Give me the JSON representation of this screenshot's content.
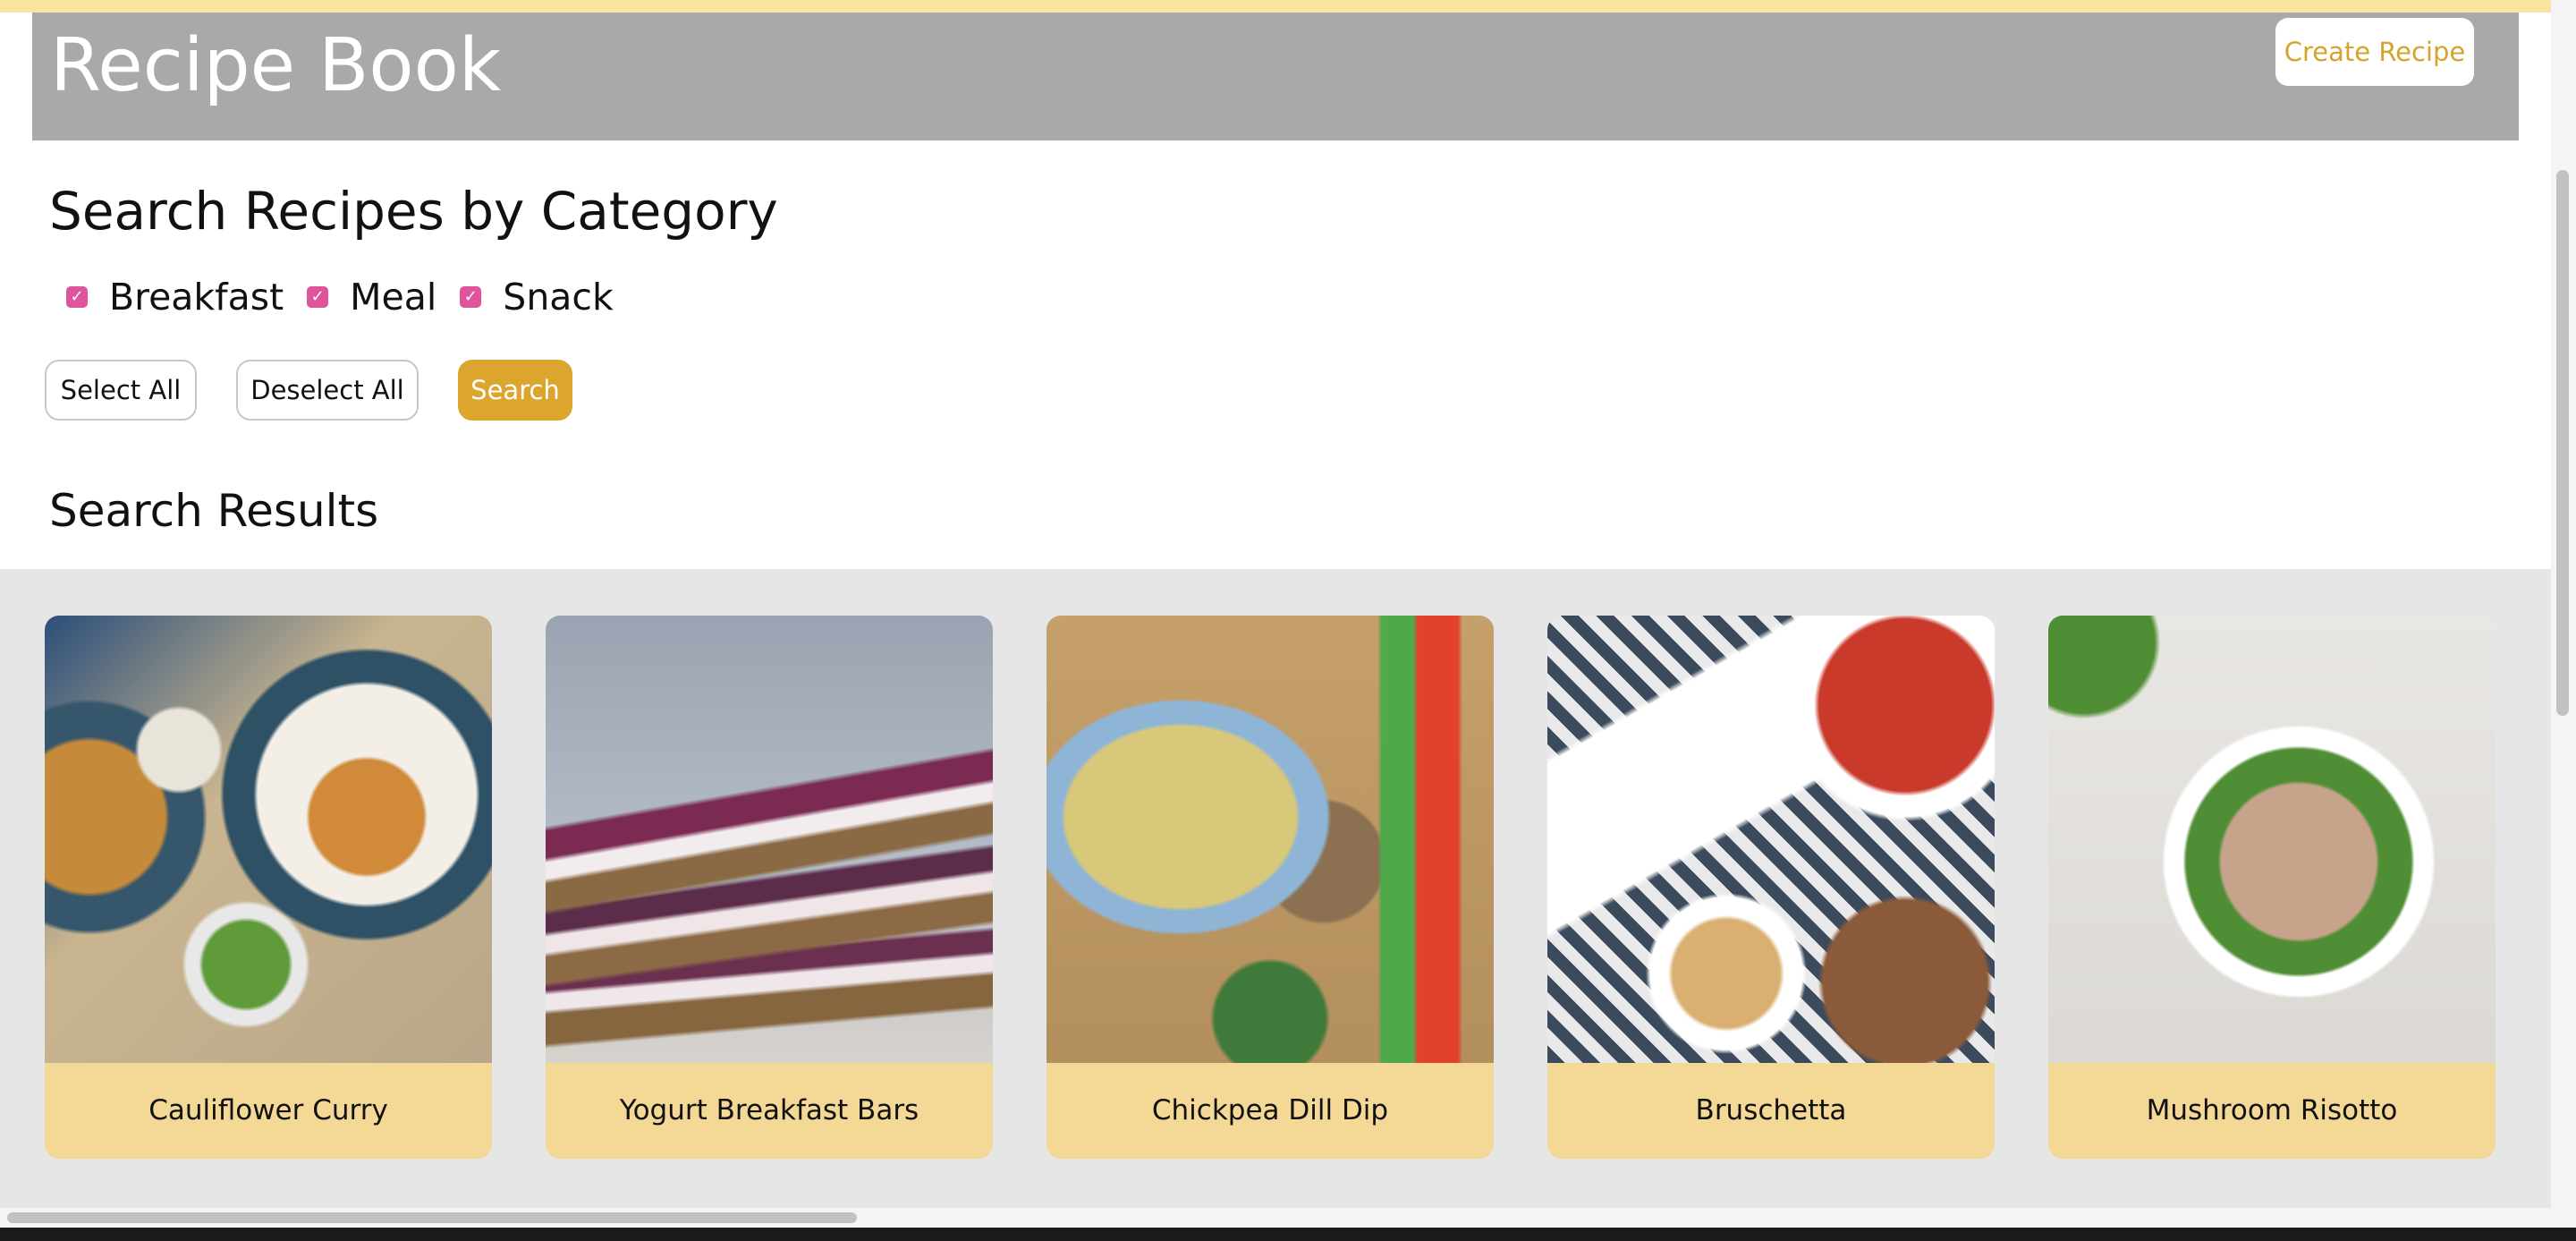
{
  "header": {
    "title": "Recipe Book",
    "create_label": "Create Recipe"
  },
  "search": {
    "heading": "Search Recipes by Category",
    "categories": [
      {
        "label": "Breakfast",
        "checked": true
      },
      {
        "label": "Meal",
        "checked": true
      },
      {
        "label": "Snack",
        "checked": true
      }
    ],
    "select_all_label": "Select All",
    "deselect_all_label": "Deselect All",
    "search_label": "Search"
  },
  "results": {
    "heading": "Search Results",
    "recipes": [
      {
        "name": "Cauliflower Curry"
      },
      {
        "name": "Yogurt Breakfast Bars"
      },
      {
        "name": "Chickpea Dill Dip"
      },
      {
        "name": "Bruschetta"
      },
      {
        "name": "Mushroom Risotto"
      }
    ]
  },
  "colors": {
    "header_bg": "#a9a9a9",
    "accent": "#dca52d",
    "card_label_bg": "#f4d896",
    "checkbox": "#e0549c",
    "results_bg": "#e6e6e6"
  }
}
